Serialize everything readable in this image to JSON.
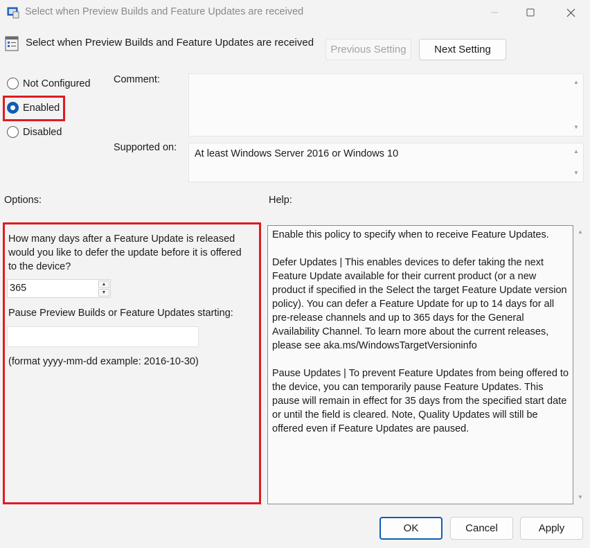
{
  "window": {
    "title": "Select when Preview Builds and Feature Updates are received",
    "icons": [
      "policy-app-icon",
      "minimize-icon",
      "maximize-icon",
      "close-icon"
    ]
  },
  "header": {
    "policy_title": "Select when Preview Builds and Feature Updates are received",
    "previous_setting": "Previous Setting",
    "next_setting": "Next Setting"
  },
  "state": {
    "options": [
      {
        "label": "Not Configured",
        "checked": false
      },
      {
        "label": "Enabled",
        "checked": true
      },
      {
        "label": "Disabled",
        "checked": false
      }
    ]
  },
  "comment": {
    "label": "Comment:",
    "value": ""
  },
  "supported": {
    "label": "Supported on:",
    "value": "At least Windows Server 2016 or Windows 10"
  },
  "options": {
    "label": "Options:",
    "defer_question": "How many days after a Feature Update is released would you like to defer the update before it is offered to the device?",
    "defer_days": "365",
    "pause_label": "Pause Preview Builds or Feature Updates starting:",
    "pause_value": "",
    "format_hint": "(format yyyy-mm-dd example: 2016-10-30)"
  },
  "help": {
    "label": "Help:",
    "paragraphs": [
      "Enable this policy to specify when to receive Feature Updates.",
      "Defer Updates | This enables devices to defer taking the next Feature Update available for their current product (or a new product if specified in the Select the target Feature Update version policy). You can defer a Feature Update for up to 14 days for all pre-release channels and up to 365 days for the General Availability Channel. To learn more about the current releases, please see aka.ms/WindowsTargetVersioninfo",
      "Pause Updates | To prevent Feature Updates from being offered to the device, you can temporarily pause Feature Updates. This pause will remain in effect for 35 days from the specified start date or until the field is cleared. Note, Quality Updates will still be offered even if Feature Updates are paused."
    ]
  },
  "footer": {
    "ok": "OK",
    "cancel": "Cancel",
    "apply": "Apply"
  },
  "colors": {
    "highlight": "#e01a22",
    "accent": "#0f5cb5"
  }
}
